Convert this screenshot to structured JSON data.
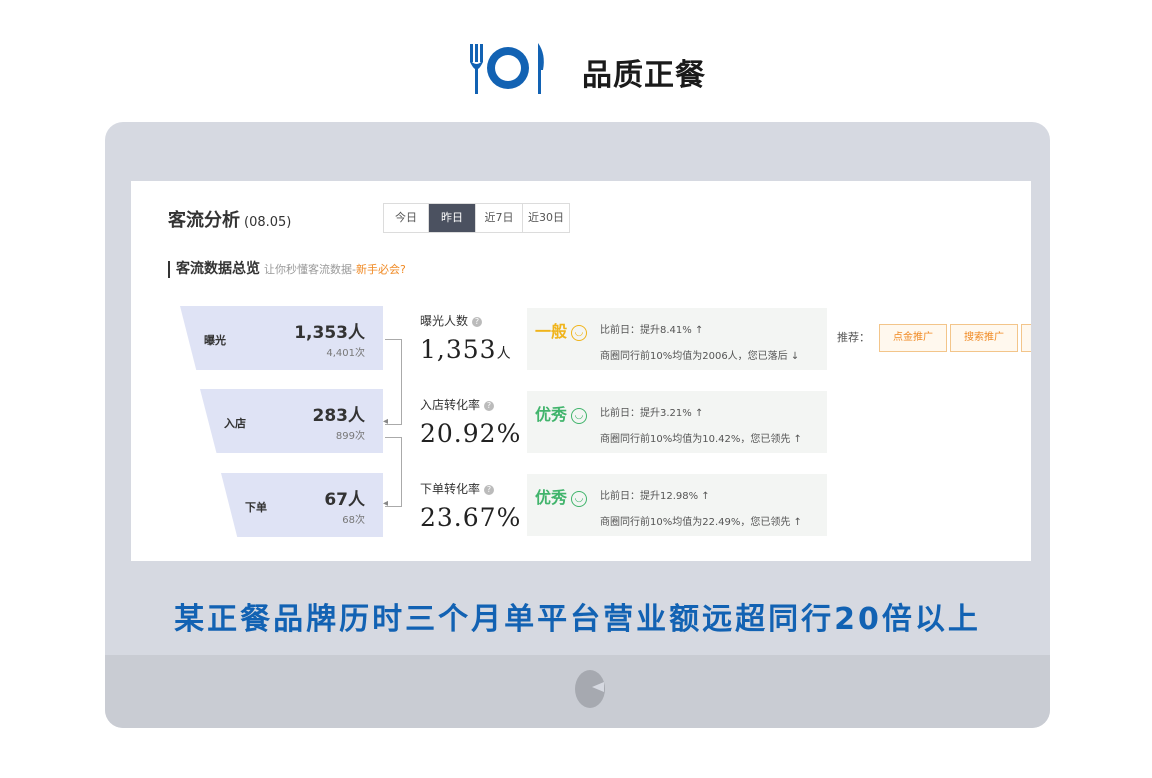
{
  "brand": {
    "title": "品质正餐",
    "logo_icon": "fork-plate-knife-icon",
    "logo_color": "#1262b3"
  },
  "monitor": {
    "caption": "某正餐品牌历时三个月单平台营业额远超同行20倍以上",
    "caption_color": "#1262b3"
  },
  "dashboard": {
    "title": "客流分析",
    "date": "(08.05)",
    "tabs": [
      {
        "label": "今日",
        "active": false
      },
      {
        "label": "昨日",
        "active": true
      },
      {
        "label": "近7日",
        "active": false
      },
      {
        "label": "近30日",
        "active": false
      }
    ],
    "overview": {
      "title": "客流数据总览",
      "hint": "让你秒懂客流数据-",
      "link": "新手必会?"
    },
    "funnel": [
      {
        "label": "曝光",
        "count": "1,353人",
        "times": "4,401次"
      },
      {
        "label": "入店",
        "count": "283人",
        "times": "899次"
      },
      {
        "label": "下单",
        "count": "67人",
        "times": "68次"
      }
    ],
    "metrics": [
      {
        "label": "曝光人数",
        "value": "1,353",
        "unit": "人",
        "grade": "一般",
        "grade_color": "#f0b41b",
        "compare": "比前日：提升8.41% ↑",
        "peer": "商圈同行前10%均值为2006人，您已落后 ↓"
      },
      {
        "label": "入店转化率",
        "value": "20.92%",
        "unit": "",
        "grade": "优秀",
        "grade_color": "#41b46c",
        "compare": "比前日：提升3.21% ↑",
        "peer": "商圈同行前10%均值为10.42%，您已领先 ↑"
      },
      {
        "label": "下单转化率",
        "value": "23.67%",
        "unit": "",
        "grade": "优秀",
        "grade_color": "#41b46c",
        "compare": "比前日：提升12.98% ↑",
        "peer": "商圈同行前10%均值为22.49%，您已领先 ↑"
      }
    ],
    "recommend": {
      "label": "推荐：",
      "buttons": [
        "点金推广",
        "搜索推广",
        ""
      ]
    }
  }
}
